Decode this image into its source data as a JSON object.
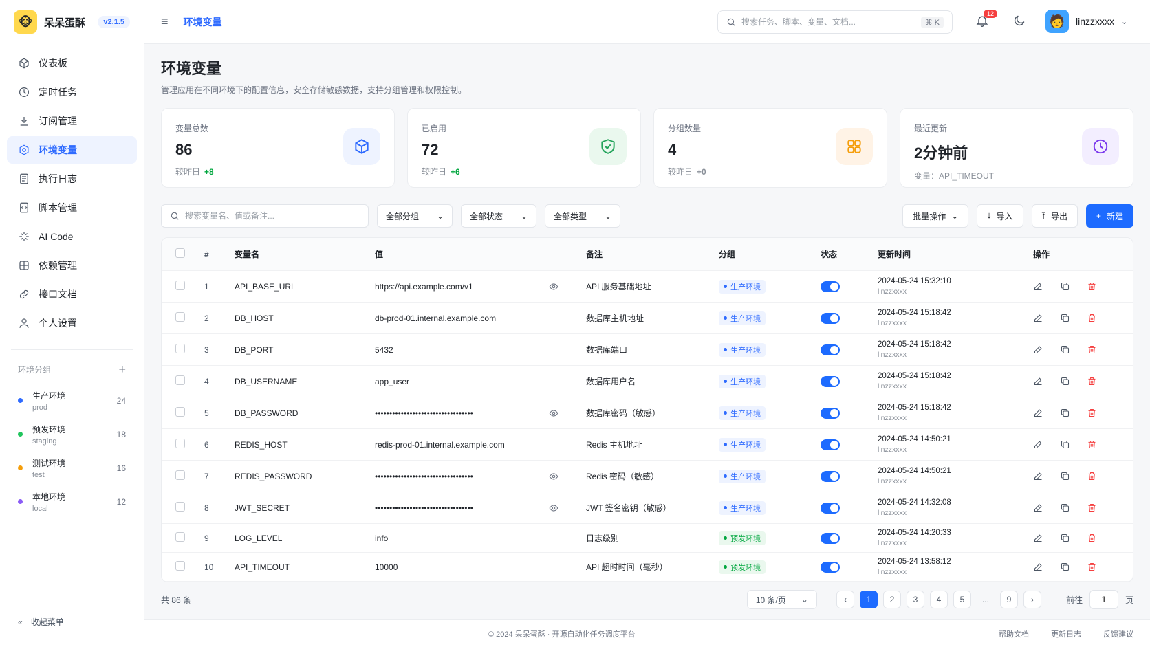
{
  "brand": {
    "name": "呆呆蛋酥",
    "version": "v2.1.5"
  },
  "nav": [
    {
      "label": "仪表板",
      "icon": "cube-icon",
      "active": false
    },
    {
      "label": "定时任务",
      "icon": "clock-icon",
      "active": false
    },
    {
      "label": "订阅管理",
      "icon": "download-icon",
      "active": false
    },
    {
      "label": "环境变量",
      "icon": "gear-icon",
      "active": true
    },
    {
      "label": "执行日志",
      "icon": "file-icon",
      "active": false
    },
    {
      "label": "脚本管理",
      "icon": "script-icon",
      "active": false
    },
    {
      "label": "AI Code",
      "icon": "sparkle-icon",
      "active": false
    },
    {
      "label": "依赖管理",
      "icon": "package-icon",
      "active": false
    },
    {
      "label": "接口文档",
      "icon": "link-icon",
      "active": false
    },
    {
      "label": "个人设置",
      "icon": "user-icon",
      "active": false
    }
  ],
  "groups": {
    "title": "环境分组",
    "items": [
      {
        "name": "生产环境",
        "sub": "prod",
        "count": "24",
        "color": "#2f6bff"
      },
      {
        "name": "预发环境",
        "sub": "staging",
        "count": "18",
        "color": "#22c55e"
      },
      {
        "name": "测试环境",
        "sub": "test",
        "count": "16",
        "color": "#f59e0b"
      },
      {
        "name": "本地环境",
        "sub": "local",
        "count": "12",
        "color": "#8b5cf6"
      }
    ]
  },
  "collapse_label": "收起菜单",
  "topbar": {
    "breadcrumb": "环境变量",
    "search_placeholder": "搜索任务、脚本、变量、文档...",
    "shortcut": "⌘ K",
    "notif_count": "12",
    "username": "linzzxxxx"
  },
  "page": {
    "title": "环境变量",
    "subtitle": "管理应用在不同环境下的配置信息，安全存储敏感数据，支持分组管理和权限控制。"
  },
  "stats": [
    {
      "label": "变量总数",
      "value": "86",
      "foot": "较昨日",
      "delta": "+8",
      "icon": "cube-icon",
      "bg": "#eef3ff",
      "color": "#2f6bff"
    },
    {
      "label": "已启用",
      "value": "72",
      "foot": "较昨日",
      "delta": "+6",
      "icon": "shield-check-icon",
      "bg": "#eaf8ee",
      "color": "#22a35a"
    },
    {
      "label": "分组数量",
      "value": "4",
      "foot": "较昨日",
      "delta": "+0",
      "icon": "grid-icon",
      "bg": "#fff3e6",
      "color": "#f59e0b"
    },
    {
      "label": "最近更新",
      "value": "2分钟前",
      "foot": "变量：API_TIMEOUT",
      "delta": "",
      "icon": "clock-icon",
      "bg": "#f3eeff",
      "color": "#7c3aed"
    }
  ],
  "toolbar": {
    "search_placeholder": "搜索变量名、值或备注...",
    "filter_group": "全部分组",
    "filter_status": "全部状态",
    "filter_type": "全部类型",
    "batch": "批量操作",
    "import": "导入",
    "export": "导出",
    "create": "新建"
  },
  "table": {
    "headers": {
      "num": "#",
      "name": "变量名",
      "value": "值",
      "note": "备注",
      "group": "分组",
      "status": "状态",
      "time": "更新时间",
      "actions": "操作"
    },
    "rows": [
      {
        "num": "1",
        "name": "API_BASE_URL",
        "value": "https://api.example.com/v1",
        "eye": true,
        "note": "API 服务基础地址",
        "group": "生产环境",
        "gclass": "prod",
        "time": "2024-05-24 15:32:10",
        "user": "linzzxxxx"
      },
      {
        "num": "2",
        "name": "DB_HOST",
        "value": "db-prod-01.internal.example.com",
        "eye": false,
        "note": "数据库主机地址",
        "group": "生产环境",
        "gclass": "prod",
        "time": "2024-05-24 15:18:42",
        "user": "linzzxxxx"
      },
      {
        "num": "3",
        "name": "DB_PORT",
        "value": "5432",
        "eye": false,
        "note": "数据库端口",
        "group": "生产环境",
        "gclass": "prod",
        "time": "2024-05-24 15:18:42",
        "user": "linzzxxxx"
      },
      {
        "num": "4",
        "name": "DB_USERNAME",
        "value": "app_user",
        "eye": false,
        "note": "数据库用户名",
        "group": "生产环境",
        "gclass": "prod",
        "time": "2024-05-24 15:18:42",
        "user": "linzzxxxx"
      },
      {
        "num": "5",
        "name": "DB_PASSWORD",
        "value": "••••••••••••••••••••••••••••••••••",
        "eye": true,
        "note": "数据库密码（敏感）",
        "group": "生产环境",
        "gclass": "prod",
        "time": "2024-05-24 15:18:42",
        "user": "linzzxxxx"
      },
      {
        "num": "6",
        "name": "REDIS_HOST",
        "value": "redis-prod-01.internal.example.com",
        "eye": false,
        "note": "Redis 主机地址",
        "group": "生产环境",
        "gclass": "prod",
        "time": "2024-05-24 14:50:21",
        "user": "linzzxxxx"
      },
      {
        "num": "7",
        "name": "REDIS_PASSWORD",
        "value": "••••••••••••••••••••••••••••••••••",
        "eye": true,
        "note": "Redis 密码（敏感）",
        "group": "生产环境",
        "gclass": "prod",
        "time": "2024-05-24 14:50:21",
        "user": "linzzxxxx"
      },
      {
        "num": "8",
        "name": "JWT_SECRET",
        "value": "••••••••••••••••••••••••••••••••••",
        "eye": true,
        "note": "JWT 签名密钥（敏感）",
        "group": "生产环境",
        "gclass": "prod",
        "time": "2024-05-24 14:32:08",
        "user": "linzzxxxx"
      },
      {
        "num": "9",
        "name": "LOG_LEVEL",
        "value": "info",
        "eye": false,
        "note": "日志级别",
        "group": "预发环境",
        "gclass": "staging",
        "time": "2024-05-24 14:20:33",
        "user": "linzzxxxx"
      },
      {
        "num": "10",
        "name": "API_TIMEOUT",
        "value": "10000",
        "eye": false,
        "note": "API 超时时间（毫秒）",
        "group": "预发环境",
        "gclass": "staging",
        "time": "2024-05-24 13:58:12",
        "user": "linzzxxxx"
      }
    ]
  },
  "pagination": {
    "total": "共 86 条",
    "page_size": "10 条/页",
    "pages": [
      "1",
      "2",
      "3",
      "4",
      "5"
    ],
    "ellipsis": "...",
    "last": "9",
    "current": "1",
    "goto_label": "前往",
    "goto_value": "1",
    "goto_suffix": "页"
  },
  "footer": {
    "copyright": "© 2024 呆呆蛋酥 · 开源自动化任务调度平台",
    "links": [
      "帮助文档",
      "更新日志",
      "反馈建议"
    ]
  }
}
